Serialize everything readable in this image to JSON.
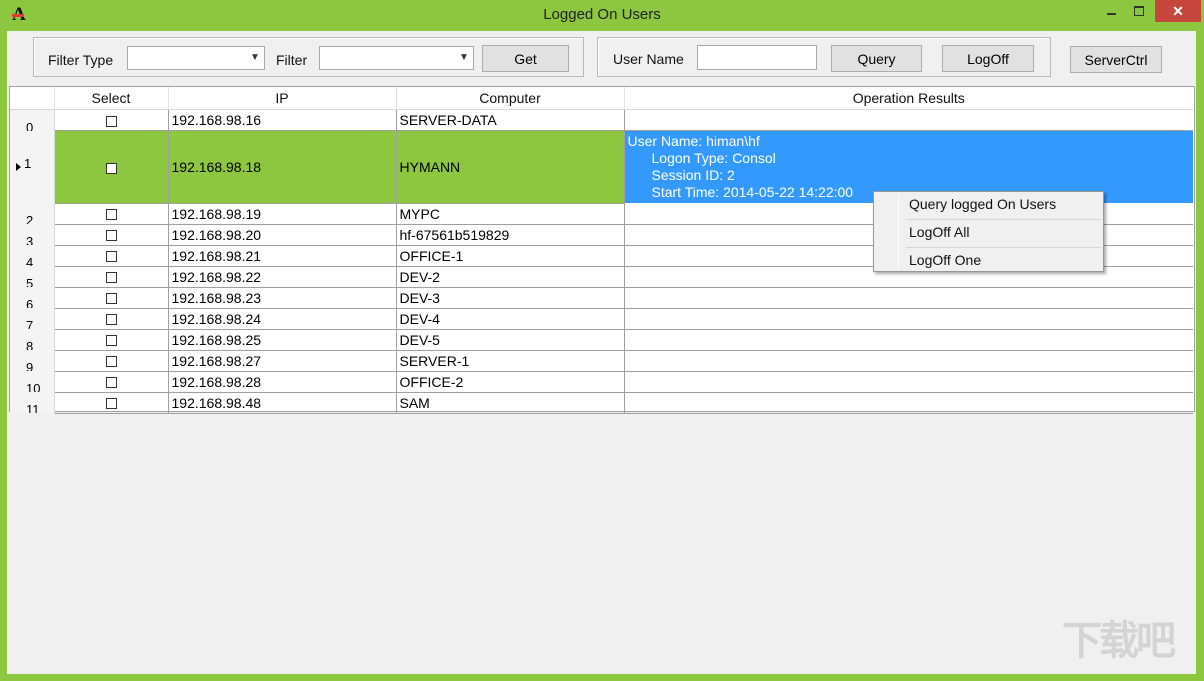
{
  "window": {
    "title": "Logged On Users",
    "close_glyph": "✕",
    "accent_color": "#8dc63f",
    "selection_color": "#3399ff"
  },
  "app_icon": {
    "glyph": "A",
    "icon": "app-logo-icon"
  },
  "toolbar": {
    "filter_type_label": "Filter Type",
    "filter_type_value": "",
    "filter_label": "Filter",
    "filter_value": "",
    "get_label": "Get",
    "user_name_label": "User Name",
    "user_name_value": "",
    "query_label": "Query",
    "logoff_label": "LogOff",
    "serverctrl_label": "ServerCtrl"
  },
  "grid": {
    "columns": [
      "Select",
      "IP",
      "Computer",
      "Operation Results"
    ],
    "rows": [
      {
        "num": "0",
        "ip": "192.168.98.16",
        "computer": "SERVER-DATA",
        "result": []
      },
      {
        "num": "1",
        "ip": "192.168.98.18",
        "computer": "HYMANN",
        "result": [
          "User Name: himan\\hf",
          "Logon Type: Consol",
          "Session ID: 2",
          "Start Time: 2014-05-22 14:22:00"
        ]
      },
      {
        "num": "2",
        "ip": "192.168.98.19",
        "computer": "MYPC",
        "result": []
      },
      {
        "num": "3",
        "ip": "192.168.98.20",
        "computer": "hf-67561b519829",
        "result": []
      },
      {
        "num": "4",
        "ip": "192.168.98.21",
        "computer": "OFFICE-1",
        "result": []
      },
      {
        "num": "5",
        "ip": "192.168.98.22",
        "computer": "DEV-2",
        "result": []
      },
      {
        "num": "6",
        "ip": "192.168.98.23",
        "computer": "DEV-3",
        "result": []
      },
      {
        "num": "7",
        "ip": "192.168.98.24",
        "computer": "DEV-4",
        "result": []
      },
      {
        "num": "8",
        "ip": "192.168.98.25",
        "computer": "DEV-5",
        "result": []
      },
      {
        "num": "9",
        "ip": "192.168.98.27",
        "computer": "SERVER-1",
        "result": []
      },
      {
        "num": "10",
        "ip": "192.168.98.28",
        "computer": "OFFICE-2",
        "result": []
      },
      {
        "num": "11",
        "ip": "192.168.98.48",
        "computer": "SAM",
        "result": []
      }
    ]
  },
  "context_menu": {
    "items": [
      "Query logged On Users",
      "LogOff All",
      "LogOff One"
    ]
  },
  "watermark": {
    "text": "下载吧"
  }
}
